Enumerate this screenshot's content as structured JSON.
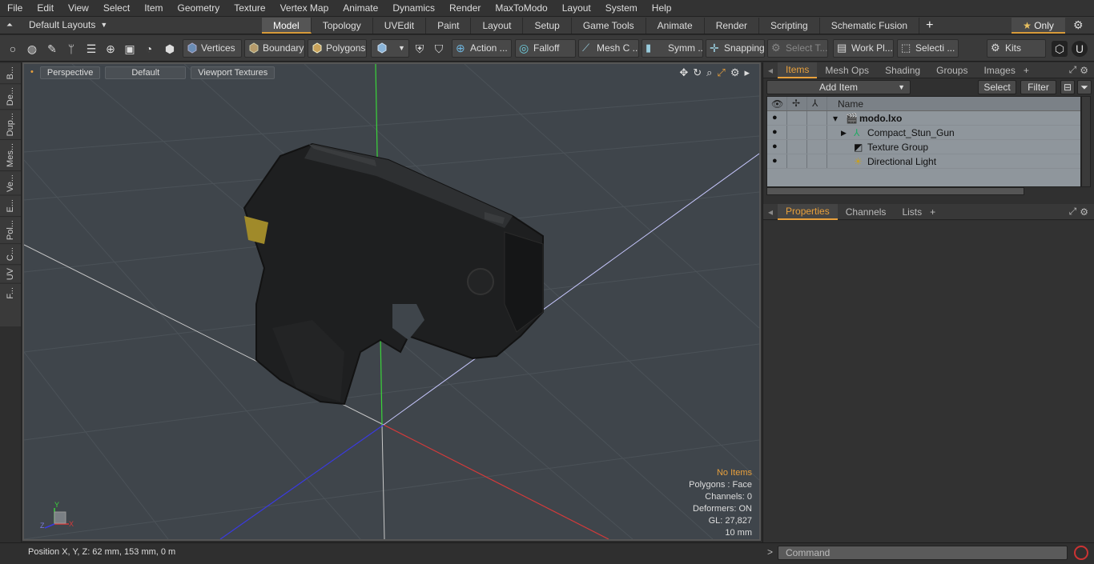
{
  "menu": [
    "File",
    "Edit",
    "View",
    "Select",
    "Item",
    "Geometry",
    "Texture",
    "Vertex Map",
    "Animate",
    "Dynamics",
    "Render",
    "MaxToModo",
    "Layout",
    "System",
    "Help"
  ],
  "layouts_label": "Default Layouts",
  "tabs": [
    "Model",
    "Topology",
    "UVEdit",
    "Paint",
    "Layout",
    "Setup",
    "Game Tools",
    "Animate",
    "Render",
    "Scripting",
    "Schematic Fusion"
  ],
  "active_tab": "Model",
  "only_label": "Only",
  "toolbar": {
    "vertices": "Vertices",
    "boundary": "Boundary",
    "polygons": "Polygons",
    "action": "Action ...",
    "falloff": "Falloff",
    "meshc": "Mesh C ...",
    "symm": "Symm ...",
    "snapping": "Snapping",
    "selectt": "Select T...",
    "workpl": "Work Pl...",
    "selecti": "Selecti ...",
    "kits": "Kits"
  },
  "left_tabs": [
    "B...",
    "De...",
    "Dup...",
    "Mes...",
    "Ve...",
    "E...",
    "Pol...",
    "C...",
    "UV",
    "F..."
  ],
  "viewport": {
    "perspective": "Perspective",
    "default": "Default",
    "textures": "Viewport Textures",
    "info": {
      "no_items": "No Items",
      "polygons": "Polygons : Face",
      "channels": "Channels: 0",
      "deformers": "Deformers: ON",
      "gl": "GL: 27,827",
      "scale": "10 mm"
    },
    "axis": {
      "y": "Y",
      "x": "X",
      "z": "Z"
    }
  },
  "status": "Position X, Y, Z:   62 mm, 153 mm, 0 m",
  "items_panel": {
    "tabs": [
      "Items",
      "Mesh Ops",
      "Shading",
      "Groups",
      "Images"
    ],
    "active": "Items",
    "add_item": "Add Item",
    "select": "Select",
    "filter": "Filter",
    "name_header": "Name",
    "rows": [
      "modo.lxo",
      "Compact_Stun_Gun",
      "Texture Group",
      "Directional Light"
    ]
  },
  "properties_panel": {
    "tabs": [
      "Properties",
      "Channels",
      "Lists"
    ],
    "active": "Properties"
  },
  "command_placeholder": "Command",
  "colors": {
    "accent": "#e8a03c",
    "x_axis": "#d43a3a",
    "y_axis": "#3ad43a",
    "z_axis": "#3a3ad4"
  }
}
